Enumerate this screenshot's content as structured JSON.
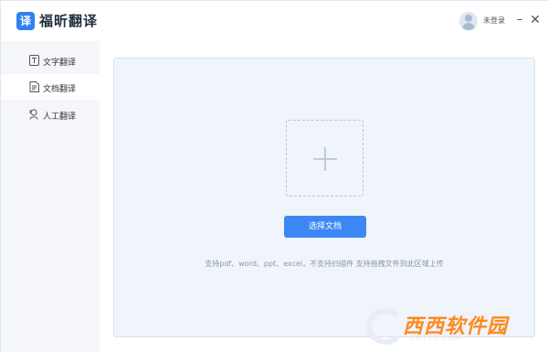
{
  "app": {
    "logo_char": "译",
    "title": "福昕翻译"
  },
  "titlebar": {
    "login_text": "未登录",
    "minimize_glyph": "–",
    "close_glyph": "✕"
  },
  "sidebar": {
    "items": [
      {
        "label": "文字翻译",
        "icon": "text-icon",
        "active": false
      },
      {
        "label": "文档翻译",
        "icon": "document-icon",
        "active": true
      },
      {
        "label": "人工翻译",
        "icon": "human-icon",
        "active": false
      }
    ]
  },
  "main": {
    "upload_icon": "plus-icon",
    "select_button": "选择文档",
    "hint": "支持pdf、word、ppt、excel，不支持扫描件 支持拖拽文件到此区域上传"
  },
  "watermark": {
    "brand": "西西软件园",
    "sub": "CR173.COM"
  },
  "colors": {
    "accent": "#3d87f5",
    "panel_bg": "#f0f4fb",
    "sidebar_bg": "#f5f6fa",
    "watermark_orange": "#ff8a1e"
  }
}
